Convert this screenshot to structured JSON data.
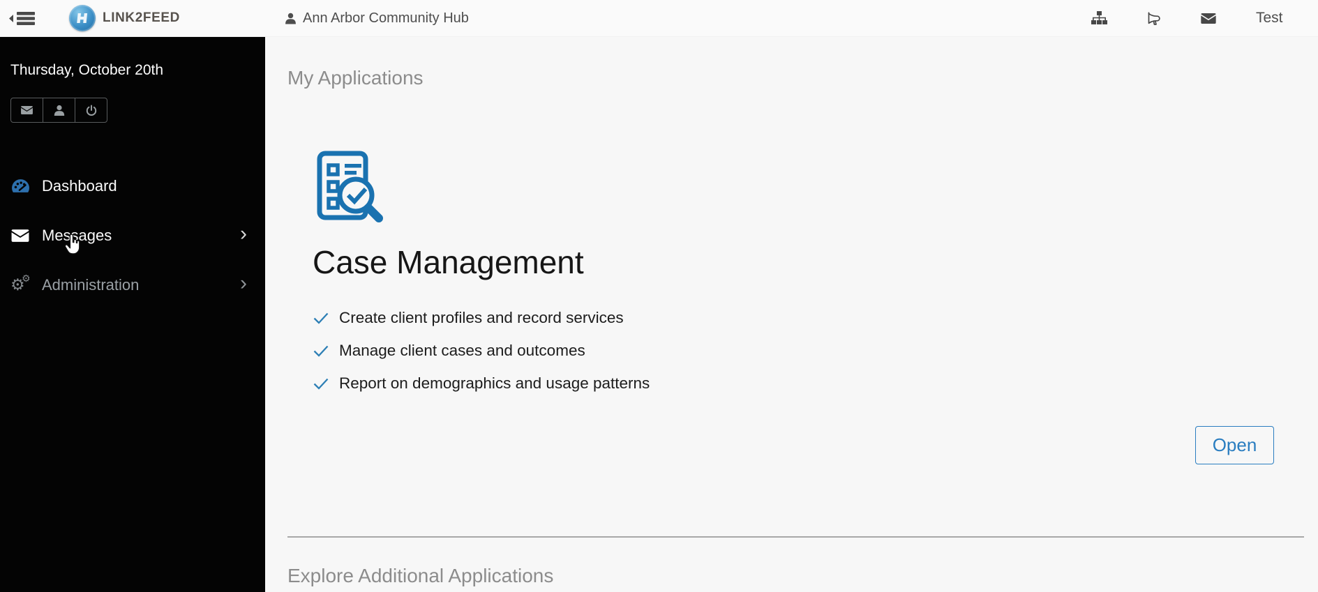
{
  "header": {
    "brand": "LINK2FEED",
    "org": "Ann Arbor Community Hub",
    "user_menu": "Test",
    "icons": [
      "collapse-menu",
      "link2feed-badge",
      "user",
      "sitemap",
      "announcements",
      "mail"
    ]
  },
  "sidebar": {
    "date": "Thursday, October 20th",
    "quick_actions": [
      "messages",
      "profile",
      "power"
    ],
    "nav": [
      {
        "label": "Dashboard",
        "icon": "dashboard-gauge",
        "has_submenu": false,
        "state": "active"
      },
      {
        "label": "Messages",
        "icon": "envelope",
        "has_submenu": true,
        "state": "normal"
      },
      {
        "label": "Administration",
        "icon": "gears",
        "has_submenu": true,
        "state": "muted"
      }
    ]
  },
  "main": {
    "section_title": "My Applications",
    "app": {
      "title": "Case Management",
      "icon": "checklist-magnifier",
      "features": [
        "Create client profiles and record services",
        "Manage client cases and outcomes",
        "Report on demographics and usage patterns"
      ],
      "open_label": "Open"
    },
    "explore_title": "Explore Additional Applications"
  },
  "glyphs": {
    "gear": "⚙",
    "chevron": "›"
  },
  "colors": {
    "accent_blue": "#1a72b0",
    "button_blue": "#2a7dc0",
    "check_blue": "#2d7fb5",
    "dashboard_blue": "#2d70ad",
    "sidebar_bg": "#040404",
    "header_bg": "#fafafa",
    "content_bg": "#f7f7f7",
    "muted_text": "#8c8c8c",
    "dark_text": "#161616"
  }
}
